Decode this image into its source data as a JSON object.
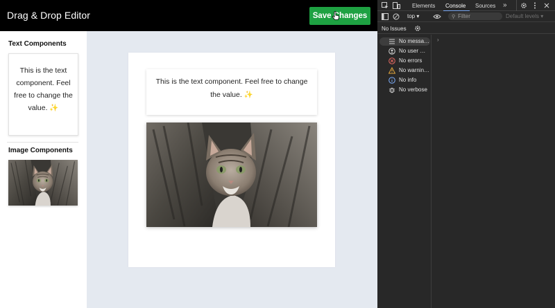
{
  "app": {
    "title": "Drag & Drop Editor",
    "save_label": "Save Changes",
    "sidebar": {
      "text_heading": "Text Components",
      "text_component": "This is the text component. Feel free to change the value. ✨",
      "image_heading": "Image Components"
    },
    "canvas": {
      "text_component": "This is the text component. Feel free to change the value. ✨"
    },
    "colors": {
      "save_button": "#1ea142",
      "topbar": "#000000",
      "canvas_bg": "#e4e9f0"
    }
  },
  "devtools": {
    "tabs": [
      "Elements",
      "Console",
      "Sources"
    ],
    "active_tab": "Console",
    "more_tabs_glyph": "»",
    "context": "top ▾",
    "filter_placeholder": "Filter",
    "levels": "Default levels ▾",
    "issues": "No Issues",
    "messages": [
      {
        "label": "No messa…",
        "icon": "list-icon"
      },
      {
        "label": "No user …",
        "icon": "user-icon"
      },
      {
        "label": "No errors",
        "icon": "error-icon"
      },
      {
        "label": "No warnin…",
        "icon": "warning-icon"
      },
      {
        "label": "No info",
        "icon": "info-icon"
      },
      {
        "label": "No verbose",
        "icon": "bug-icon"
      }
    ],
    "expand_glyph": "›"
  }
}
